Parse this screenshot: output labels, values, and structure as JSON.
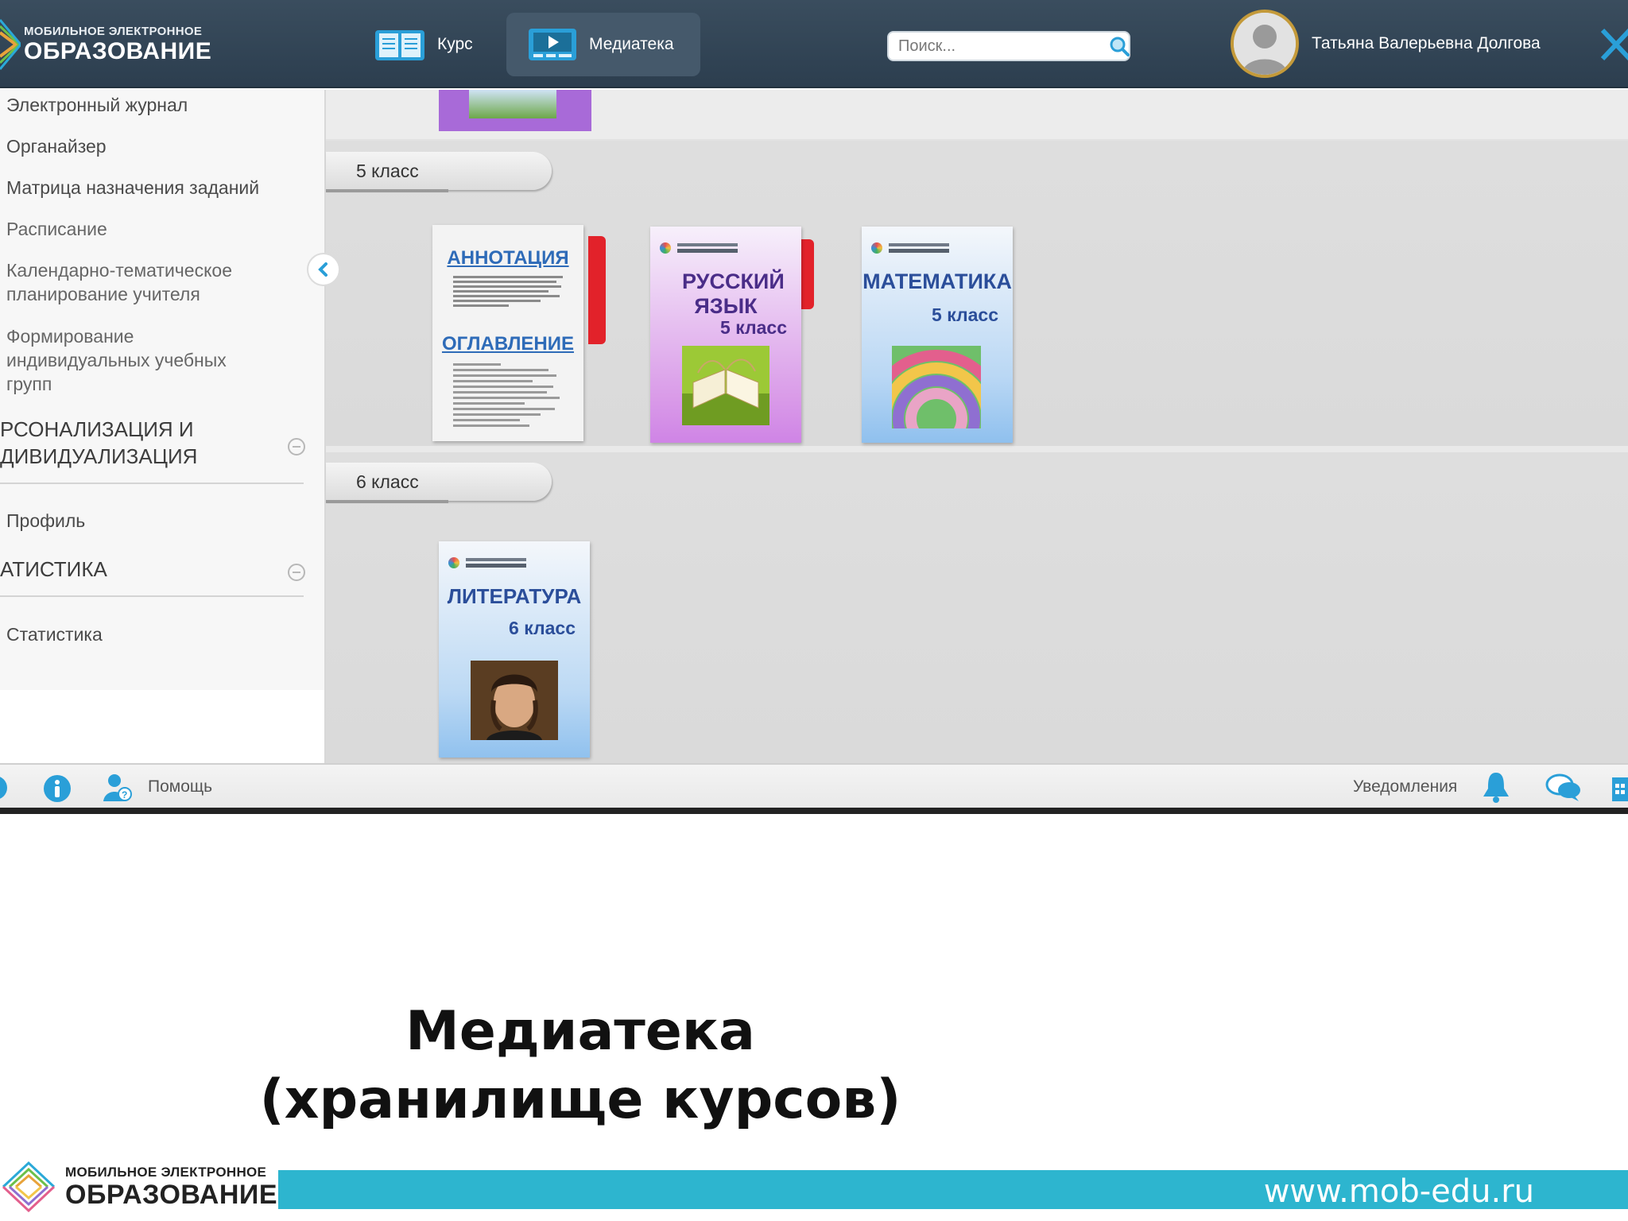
{
  "app": {
    "logo": {
      "line1": "МОБИЛЬНОЕ ЭЛЕКТРОННОЕ",
      "line2": "ОБРАЗОВАНИЕ"
    }
  },
  "header": {
    "tabs": [
      {
        "label": "Курс",
        "icon": "book-icon",
        "active": false
      },
      {
        "label": "Медиатека",
        "icon": "video-icon",
        "active": true
      }
    ],
    "search": {
      "placeholder": "Поиск...",
      "value": ""
    },
    "user": {
      "name": "Татьяна Валерьевна Долгова"
    }
  },
  "sidebar": {
    "items_top": [
      "Электронный журнал",
      "Органайзер",
      "Матрица назначения заданий",
      "Расписание",
      "Календарно-тематическое планирование учителя",
      "Формирование индивидуальных учебных групп"
    ],
    "sections": [
      {
        "title": "РСОНАЛИЗАЦИЯ И ДИВИДУАЛИЗАЦИЯ",
        "items": [
          "Профиль"
        ]
      },
      {
        "title": "АТИСТИКА",
        "items": [
          "Статистика"
        ]
      }
    ]
  },
  "library": {
    "grades": [
      {
        "label": "5 класс",
        "books": [
          {
            "heading1": "АННОТАЦИЯ",
            "heading2": "ОГЛАВЛЕНИЕ"
          },
          {
            "title": "РУССКИЙ ЯЗЫК",
            "grade": "5 класс"
          },
          {
            "title": "МАТЕМАТИКА",
            "grade": "5 класс"
          }
        ]
      },
      {
        "label": "6 класс",
        "books": [
          {
            "title": "ЛИТЕРАТУРА",
            "grade": "6 класс"
          }
        ]
      }
    ]
  },
  "toolbar": {
    "help_label": "Помощь",
    "notifications_label": "Уведомления"
  },
  "slide": {
    "title_line1": "Медиатека",
    "title_line2": "(хранилище курсов)",
    "footer_logo": {
      "line1": "МОБИЛЬНОЕ ЭЛЕКТРОННОЕ",
      "line2": "ОБРАЗОВАНИЕ"
    },
    "url": "www.mob-edu.ru"
  },
  "colors": {
    "header_bg": "#2f4252",
    "accent_blue": "#2a9fd8",
    "footer_bar": "#2db5cf",
    "red_tab": "#e2222a",
    "avatar_ring": "#c49a3a"
  }
}
